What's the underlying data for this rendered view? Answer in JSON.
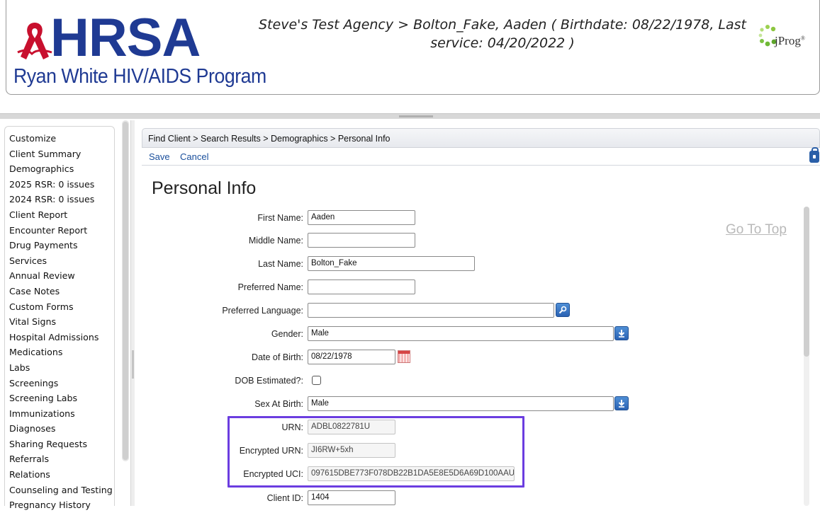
{
  "header": {
    "logo_text": "HRSA",
    "logo_subtitle": "Ryan White HIV/AIDS Program",
    "title": "Steve's Test Agency > Bolton_Fake, Aaden ( Birthdate: 08/22/1978, Last service: 04/20/2022 )",
    "brand": "jProg",
    "brand_mark": "®"
  },
  "sidebar": {
    "items": [
      "Customize",
      "Client Summary",
      "Demographics",
      "2025 RSR: 0 issues",
      "2024 RSR: 0 issues",
      "Client Report",
      "Encounter Report",
      "Drug Payments",
      "Services",
      "Annual Review",
      "Case Notes",
      "Custom Forms",
      "Vital Signs",
      "Hospital Admissions",
      "Medications",
      "Labs",
      "Screenings",
      "Screening Labs",
      "Immunizations",
      "Diagnoses",
      "Sharing Requests",
      "Referrals",
      "Relations",
      "Counseling and Testing",
      "Pregnancy History"
    ]
  },
  "main": {
    "breadcrumb": "Find Client > Search Results > Demographics > Personal Info",
    "save_label": "Save",
    "cancel_label": "Cancel",
    "page_title": "Personal Info",
    "go_to_top": "Go To Top"
  },
  "form": {
    "first_name": {
      "label": "First Name:",
      "value": "Aaden"
    },
    "middle_name": {
      "label": "Middle Name:",
      "value": ""
    },
    "last_name": {
      "label": "Last Name:",
      "value": "Bolton_Fake"
    },
    "preferred_name": {
      "label": "Preferred Name:",
      "value": ""
    },
    "preferred_language": {
      "label": "Preferred Language:",
      "value": ""
    },
    "gender": {
      "label": "Gender:",
      "value": "Male"
    },
    "dob": {
      "label": "Date of Birth:",
      "value": "08/22/1978"
    },
    "dob_estimated": {
      "label": "DOB Estimated?:",
      "checked": false
    },
    "sex_at_birth": {
      "label": "Sex At Birth:",
      "value": "Male"
    },
    "urn": {
      "label": "URN:",
      "value": "ADBL0822781U"
    },
    "encrypted_urn": {
      "label": "Encrypted URN:",
      "value": "JI6RW+5xh"
    },
    "encrypted_uci": {
      "label": "Encrypted UCI:",
      "value": "097615DBE773F078DB22B1DA5E8E5D6A69D100AAU"
    },
    "client_id": {
      "label": "Client ID:",
      "value": "1404"
    }
  },
  "colors": {
    "brand_blue": "#1f3a93",
    "ribbon_red": "#c8102e",
    "link_blue": "#1a4f9c",
    "highlight_purple": "#6b3de0",
    "jprog_green": "#7cc242"
  }
}
